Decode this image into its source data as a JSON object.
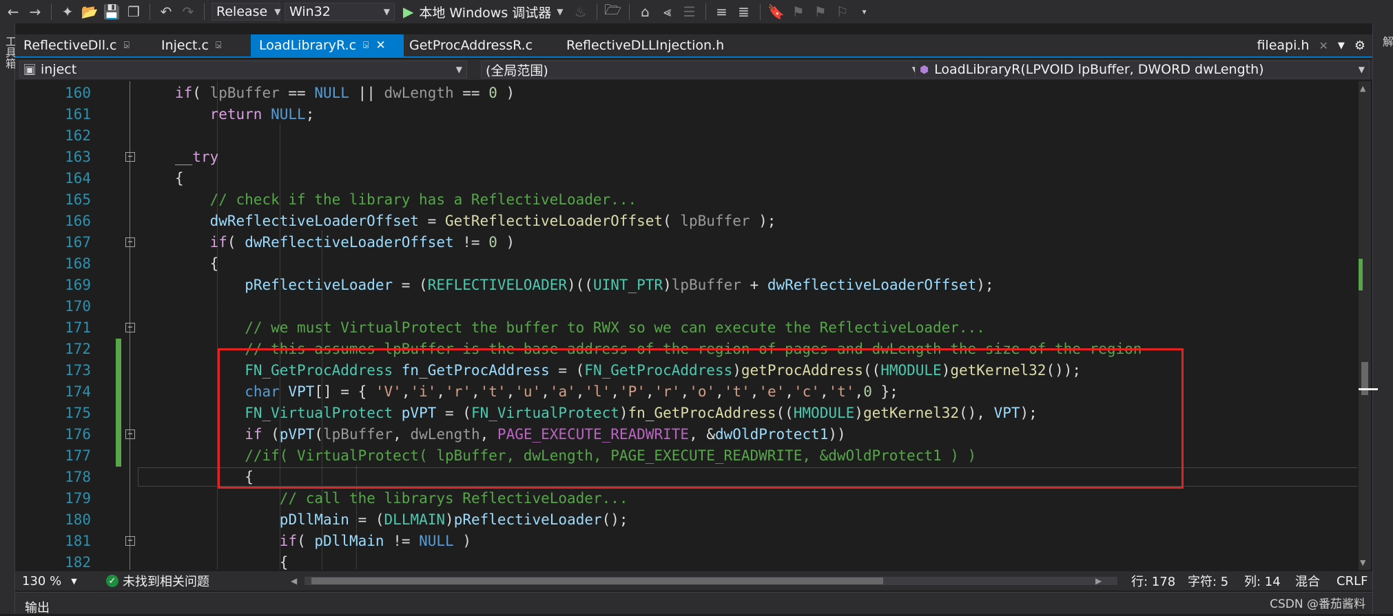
{
  "toolbar": {
    "config": "Release",
    "platform": "Win32",
    "debugger": "本地 Windows 调试器"
  },
  "tabs": [
    {
      "label": "ReflectiveDll.c"
    },
    {
      "label": "Inject.c"
    },
    {
      "label": "LoadLibraryR.c"
    },
    {
      "label": "GetProcAddressR.c"
    },
    {
      "label": "ReflectiveDLLInjection.h"
    }
  ],
  "tabs_right": {
    "label": "fileapi.h"
  },
  "nav": {
    "project": "inject",
    "scope": "(全局范围)",
    "member": "LoadLibraryR(LPVOID lpBuffer, DWORD dwLength)"
  },
  "side": {
    "left_label": "工具箱",
    "right_label": "解"
  },
  "lines": [
    {
      "n": "160",
      "text": ""
    },
    {
      "n": "161",
      "text": ""
    },
    {
      "n": "162",
      "text": ""
    },
    {
      "n": "163",
      "text": ""
    },
    {
      "n": "164",
      "text": ""
    },
    {
      "n": "165",
      "text": ""
    },
    {
      "n": "166",
      "text": ""
    },
    {
      "n": "167",
      "text": ""
    },
    {
      "n": "168",
      "text": ""
    },
    {
      "n": "169",
      "text": ""
    },
    {
      "n": "170",
      "text": ""
    },
    {
      "n": "171",
      "text": ""
    },
    {
      "n": "172",
      "text": ""
    },
    {
      "n": "173",
      "text": ""
    },
    {
      "n": "174",
      "text": ""
    },
    {
      "n": "175",
      "text": ""
    },
    {
      "n": "176",
      "text": ""
    },
    {
      "n": "177",
      "text": ""
    },
    {
      "n": "178",
      "text": ""
    },
    {
      "n": "179",
      "text": ""
    },
    {
      "n": "180",
      "text": ""
    },
    {
      "n": "181",
      "text": ""
    },
    {
      "n": "182",
      "text": ""
    }
  ],
  "code": {
    "l160": [
      [
        "ctrl",
        "if"
      ],
      [
        "",
        "( "
      ],
      [
        "prm",
        "lpBuffer"
      ],
      [
        "",
        " == "
      ],
      [
        "kw",
        "NULL"
      ],
      [
        "",
        " || "
      ],
      [
        "prm",
        "dwLength"
      ],
      [
        "",
        " == "
      ],
      [
        "num",
        "0"
      ],
      [
        "",
        " )"
      ]
    ],
    "l161": [
      [
        "ctrl",
        "return"
      ],
      [
        "",
        " "
      ],
      [
        "kw",
        "NULL"
      ],
      [
        "",
        ";"
      ]
    ],
    "l163": [
      [
        "ctrl",
        "__try"
      ]
    ],
    "l164": [
      [
        "",
        "{"
      ]
    ],
    "l165": [
      [
        "cm",
        "// check if the library has a ReflectiveLoader..."
      ]
    ],
    "l166": [
      [
        "var",
        "dwReflectiveLoaderOffset"
      ],
      [
        "",
        " = "
      ],
      [
        "fn",
        "GetReflectiveLoaderOffset"
      ],
      [
        "",
        "( "
      ],
      [
        "prm",
        "lpBuffer"
      ],
      [
        "",
        " );"
      ]
    ],
    "l167": [
      [
        "ctrl",
        "if"
      ],
      [
        "",
        "( "
      ],
      [
        "var",
        "dwReflectiveLoaderOffset"
      ],
      [
        "",
        " != "
      ],
      [
        "num",
        "0"
      ],
      [
        "",
        " )"
      ]
    ],
    "l168": [
      [
        "",
        "{"
      ]
    ],
    "l169": [
      [
        "var",
        "pReflectiveLoader"
      ],
      [
        "",
        " = ("
      ],
      [
        "ty",
        "REFLECTIVELOADER"
      ],
      [
        "",
        ")(("
      ],
      [
        "ty",
        "UINT_PTR"
      ],
      [
        "",
        ")"
      ],
      [
        "prm",
        "lpBuffer"
      ],
      [
        "",
        " + "
      ],
      [
        "var",
        "dwReflectiveLoaderOffset"
      ],
      [
        "",
        ");"
      ]
    ],
    "l171": [
      [
        "cm",
        "// we must VirtualProtect the buffer to RWX so we can execute the ReflectiveLoader..."
      ]
    ],
    "l172": [
      [
        "cm",
        "// this assumes lpBuffer is the base address of the region of pages and dwLength the size of the region"
      ]
    ],
    "l173": [
      [
        "ty",
        "FN_GetProcAddress"
      ],
      [
        "",
        " "
      ],
      [
        "var",
        "fn_GetProcAddress"
      ],
      [
        "",
        " = ("
      ],
      [
        "ty",
        "FN_GetProcAddress"
      ],
      [
        "",
        ")"
      ],
      [
        "fn",
        "getProcAddress"
      ],
      [
        "",
        "(("
      ],
      [
        "ty",
        "HMODULE"
      ],
      [
        "",
        ")"
      ],
      [
        "fn",
        "getKernel32"
      ],
      [
        "",
        "());"
      ]
    ],
    "l174": [
      [
        "kw",
        "char"
      ],
      [
        "",
        " "
      ],
      [
        "var",
        "VPT"
      ],
      [
        "",
        "[] = { "
      ],
      [
        "str",
        "'V'"
      ],
      [
        "",
        ","
      ],
      [
        "str",
        "'i'"
      ],
      [
        "",
        ","
      ],
      [
        "str",
        "'r'"
      ],
      [
        "",
        ","
      ],
      [
        "str",
        "'t'"
      ],
      [
        "",
        ","
      ],
      [
        "str",
        "'u'"
      ],
      [
        "",
        ","
      ],
      [
        "str",
        "'a'"
      ],
      [
        "",
        ","
      ],
      [
        "str",
        "'l'"
      ],
      [
        "",
        ","
      ],
      [
        "str",
        "'P'"
      ],
      [
        "",
        ","
      ],
      [
        "str",
        "'r'"
      ],
      [
        "",
        ","
      ],
      [
        "str",
        "'o'"
      ],
      [
        "",
        ","
      ],
      [
        "str",
        "'t'"
      ],
      [
        "",
        ","
      ],
      [
        "str",
        "'e'"
      ],
      [
        "",
        ","
      ],
      [
        "str",
        "'c'"
      ],
      [
        "",
        ","
      ],
      [
        "str",
        "'t'"
      ],
      [
        "",
        ","
      ],
      [
        "num",
        "0"
      ],
      [
        "",
        " };"
      ]
    ],
    "l175": [
      [
        "ty",
        "FN_VirtualProtect"
      ],
      [
        "",
        " "
      ],
      [
        "var",
        "pVPT"
      ],
      [
        "",
        " = ("
      ],
      [
        "ty",
        "FN_VirtualProtect"
      ],
      [
        "",
        ")"
      ],
      [
        "fn",
        "fn_GetProcAddress"
      ],
      [
        "",
        "(("
      ],
      [
        "ty",
        "HMODULE"
      ],
      [
        "",
        ")"
      ],
      [
        "fn",
        "getKernel32"
      ],
      [
        "",
        "(), "
      ],
      [
        "var",
        "VPT"
      ],
      [
        "",
        ");"
      ]
    ],
    "l176": [
      [
        "ctrl",
        "if"
      ],
      [
        "",
        " ("
      ],
      [
        "var",
        "pVPT"
      ],
      [
        "",
        "("
      ],
      [
        "prm",
        "lpBuffer"
      ],
      [
        "",
        ", "
      ],
      [
        "prm",
        "dwLength"
      ],
      [
        "",
        ", "
      ],
      [
        "mac",
        "PAGE_EXECUTE_READWRITE"
      ],
      [
        "",
        ", &"
      ],
      [
        "var",
        "dwOldProtect1"
      ],
      [
        "",
        "))"
      ]
    ],
    "l177": [
      [
        "cm",
        "//if( VirtualProtect( lpBuffer, dwLength, PAGE_EXECUTE_READWRITE, &dwOldProtect1 ) )"
      ]
    ],
    "l178": [
      [
        "",
        "{"
      ]
    ],
    "l179": [
      [
        "cm",
        "// call the librarys ReflectiveLoader..."
      ]
    ],
    "l180": [
      [
        "var",
        "pDllMain"
      ],
      [
        "",
        " = ("
      ],
      [
        "ty",
        "DLLMAIN"
      ],
      [
        "",
        ")"
      ],
      [
        "var",
        "pReflectiveLoader"
      ],
      [
        "",
        "();"
      ]
    ],
    "l181": [
      [
        "ctrl",
        "if"
      ],
      [
        "",
        "( "
      ],
      [
        "var",
        "pDllMain"
      ],
      [
        "",
        " != "
      ],
      [
        "kw",
        "NULL"
      ],
      [
        "",
        " )"
      ]
    ],
    "l182": [
      [
        "",
        "{"
      ]
    ]
  },
  "status": {
    "zoom": "130 %",
    "issues": "未找到相关问题",
    "row": "行: 178",
    "char": "字符: 5",
    "col": "列: 14",
    "mix": "混合",
    "eol": "CRLF"
  },
  "output": {
    "title": "输出"
  },
  "watermark": "CSDN @番茄酱料",
  "colors": {
    "accent": "#007acc",
    "highlight_box": "#e52222",
    "comment": "#57a64a",
    "keyword": "#569cd6",
    "type": "#4ec9b0"
  }
}
